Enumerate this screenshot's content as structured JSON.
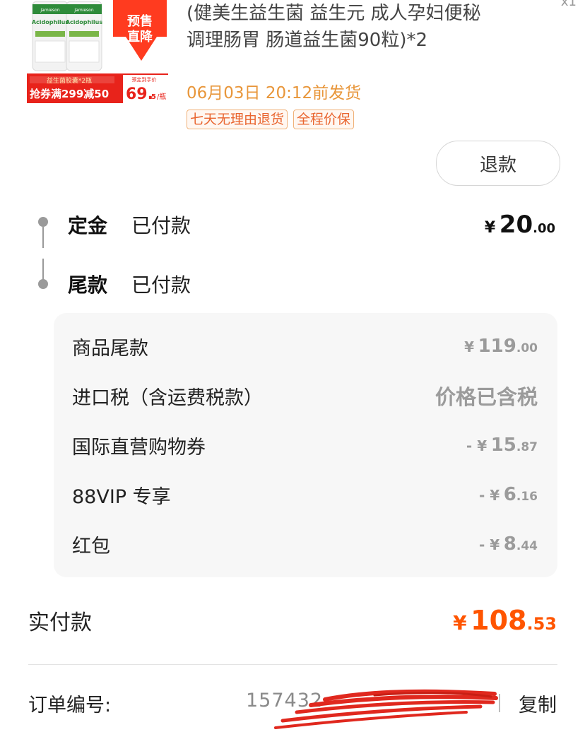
{
  "product": {
    "image_texts": {
      "brand": "Jamieson",
      "name": "Acidophilus",
      "badge_line1": "预售",
      "badge_line2": "直降",
      "promo_top": "益生菌胶囊*2瓶",
      "promo_main": "抢券满299减50",
      "price_label": "预定到手价",
      "price": "69.",
      "price_unit": "5",
      "price_tail": "/瓶"
    },
    "title": "(健美生益生菌 益生元 成人孕妇便秘调理肠胃 肠道益生菌90粒)*2",
    "quantity": "x1",
    "ship_time": "06月03日 20:12前发货",
    "tags": [
      "七天无理由退货",
      "全程价保"
    ],
    "refund_label": "退款"
  },
  "payment_stages": [
    {
      "name": "定金",
      "status": "已付款",
      "currency": "¥",
      "amount_int": "20",
      "amount_dec": ".00"
    },
    {
      "name": "尾款",
      "status": "已付款"
    }
  ],
  "breakdown": [
    {
      "label": "商品尾款",
      "sign": "",
      "currency": "¥",
      "amount_int": "119",
      "amount_dec": ".00"
    },
    {
      "label": "进口税（含运费税款）",
      "text_value": "价格已含税"
    },
    {
      "label": "国际直营购物券",
      "sign": "- ",
      "currency": "¥",
      "amount_int": "15",
      "amount_dec": ".87"
    },
    {
      "label": "88VIP 专享",
      "sign": "- ",
      "currency": "¥",
      "amount_int": "6",
      "amount_dec": ".16"
    },
    {
      "label": "红包",
      "sign": "- ",
      "currency": "¥",
      "amount_int": "8",
      "amount_dec": ".44"
    }
  ],
  "actual_paid": {
    "label": "实付款",
    "currency": "¥",
    "amount_int": "108",
    "amount_dec": ".53"
  },
  "order": {
    "label": "订单编号:",
    "number_visible": "157432",
    "copy_label": "复制"
  },
  "colors": {
    "accent": "#ff5500",
    "ship_time": "#e8963a",
    "tag": "#e9652f",
    "muted": "#9b9b9b",
    "redaction": "#e0281e"
  }
}
